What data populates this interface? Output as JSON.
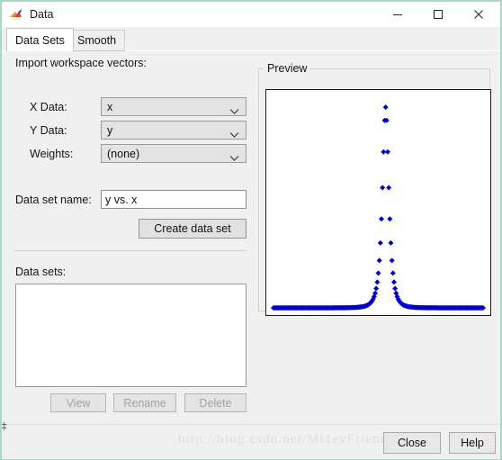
{
  "window": {
    "title": "Data",
    "app_icon": "matlab-membrane-icon",
    "controls": {
      "minimize": "minimize-icon",
      "maximize": "maximize-icon",
      "close": "close-icon"
    },
    "border_color": "#a8d8c8"
  },
  "tabs": [
    {
      "label": "Data Sets",
      "active": true
    },
    {
      "label": "Smooth",
      "active": false
    }
  ],
  "form": {
    "section_title": "Import workspace vectors:",
    "fields": [
      {
        "label": "X Data:",
        "value": "x",
        "icon": "chevron-down-icon"
      },
      {
        "label": "Y Data:",
        "value": "y",
        "icon": "chevron-down-icon"
      },
      {
        "label": "Weights:",
        "value": "(none)",
        "icon": "chevron-down-icon"
      }
    ],
    "name_label": "Data set name:",
    "name_value": "y vs. x",
    "create_button": "Create data set"
  },
  "datasets": {
    "label": "Data sets:",
    "items": [],
    "actions": [
      {
        "label": "View",
        "enabled": false
      },
      {
        "label": "Rename",
        "enabled": false
      },
      {
        "label": "Delete",
        "enabled": false
      }
    ]
  },
  "preview": {
    "title": "Preview"
  },
  "footer": {
    "watermark": "http://blog.csdn.net/Mi1eyFriends",
    "close_button": "Close",
    "help_button": "Help"
  },
  "chart_data": {
    "type": "scatter",
    "title": "",
    "xlabel": "",
    "ylabel": "",
    "marker": "diamond",
    "marker_color": "#0000cc",
    "marker_size": 3,
    "grid": false,
    "legend": null,
    "axes_visible_box": true,
    "ticks": [],
    "xlim": [
      -10,
      10
    ],
    "ylim": [
      0,
      1.05
    ],
    "description": "Sharp Lorentzian-like peak centered near x = 0.7 with long flat tails",
    "peak": {
      "x": 0.7,
      "y": 1.0,
      "half_width": 0.38
    },
    "n_points": 201,
    "x": [
      -10,
      -9.9,
      -9.8,
      -9.7,
      -9.6,
      -9.5,
      -9.4,
      -9.3,
      -9.2,
      -9.1,
      -9,
      -8.9,
      -8.8,
      -8.7,
      -8.6,
      -8.5,
      -8.4,
      -8.3,
      -8.2,
      -8.1,
      -8,
      -7.9,
      -7.8,
      -7.7,
      -7.6,
      -7.5,
      -7.4,
      -7.3,
      -7.2,
      -7.1,
      -7,
      -6.9,
      -6.8,
      -6.7,
      -6.6,
      -6.5,
      -6.4,
      -6.3,
      -6.2,
      -6.1,
      -6,
      -5.9,
      -5.8,
      -5.7,
      -5.6,
      -5.5,
      -5.4,
      -5.3,
      -5.2,
      -5.1,
      -5,
      -4.9,
      -4.8,
      -4.7,
      -4.6,
      -4.5,
      -4.4,
      -4.3,
      -4.2,
      -4.1,
      -4,
      -3.9,
      -3.8,
      -3.7,
      -3.6,
      -3.5,
      -3.4,
      -3.3,
      -3.2,
      -3.1,
      -3,
      -2.9,
      -2.8,
      -2.7,
      -2.6,
      -2.5,
      -2.4,
      -2.3,
      -2.2,
      -2.1,
      -2,
      -1.9,
      -1.8,
      -1.7,
      -1.6,
      -1.5,
      -1.4,
      -1.3,
      -1.2,
      -1.1,
      -1,
      -0.9,
      -0.8,
      -0.7,
      -0.6,
      -0.5,
      -0.4,
      -0.3,
      -0.2,
      -0.1,
      0,
      0.1,
      0.2,
      0.3,
      0.4,
      0.5,
      0.6,
      0.7,
      0.8,
      0.9,
      1,
      1.1,
      1.2,
      1.3,
      1.4,
      1.5,
      1.6,
      1.7,
      1.8,
      1.9,
      2,
      2.1,
      2.2,
      2.3,
      2.4,
      2.5,
      2.6,
      2.7,
      2.8,
      2.9,
      3,
      3.1,
      3.2,
      3.3,
      3.4,
      3.5,
      3.6,
      3.7,
      3.8,
      3.9,
      4,
      4.1,
      4.2,
      4.3,
      4.4,
      4.5,
      4.6,
      4.7,
      4.8,
      4.9,
      5,
      5.1,
      5.2,
      5.3,
      5.4,
      5.5,
      5.6,
      5.7,
      5.8,
      5.9,
      6,
      6.1,
      6.2,
      6.3,
      6.4,
      6.5,
      6.6,
      6.7,
      6.8,
      6.9,
      7,
      7.1,
      7.2,
      7.3,
      7.4,
      7.5,
      7.6,
      7.7,
      7.8,
      7.9,
      8,
      8.1,
      8.2,
      8.3,
      8.4,
      8.5,
      8.6,
      8.7,
      8.8,
      8.9,
      9,
      9.1,
      9.2,
      9.3,
      9.4,
      9.5,
      9.6,
      9.7,
      9.8,
      9.9,
      10
    ]
  }
}
